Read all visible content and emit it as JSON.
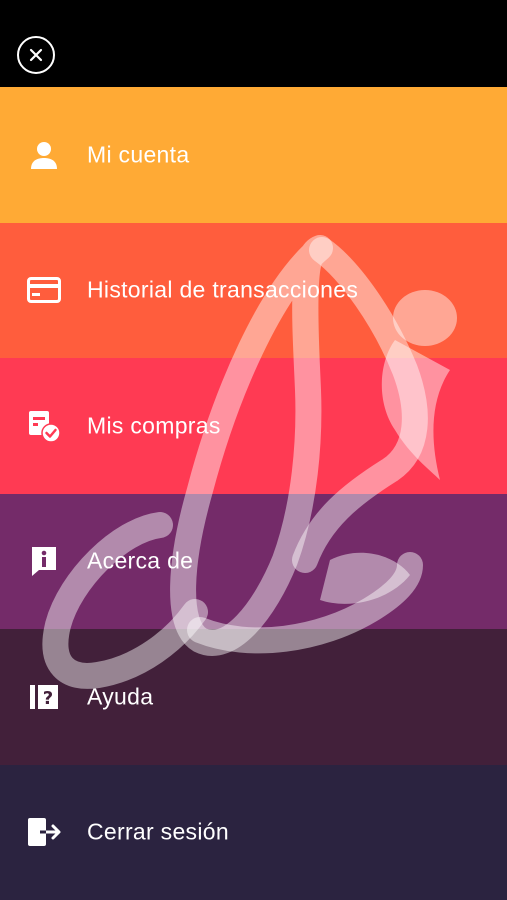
{
  "header": {
    "close_icon": "close-circle-icon"
  },
  "menu": {
    "items": [
      {
        "label": "Mi cuenta",
        "icon": "user-icon",
        "color": "#FFAA35"
      },
      {
        "label": "Historial de transacciones",
        "icon": "credit-card-icon",
        "color": "#FF5D3D"
      },
      {
        "label": "Mis compras",
        "icon": "purchases-icon",
        "color": "#FF3A53"
      },
      {
        "label": "Acerca de",
        "icon": "info-icon",
        "color": "#742B69"
      },
      {
        "label": "Ayuda",
        "icon": "help-book-icon",
        "color": "#42203A"
      },
      {
        "label": "Cerrar sesión",
        "icon": "logout-icon",
        "color": "#2B2340"
      }
    ]
  },
  "watermark": {
    "icon": "brand-logo-watermark"
  }
}
